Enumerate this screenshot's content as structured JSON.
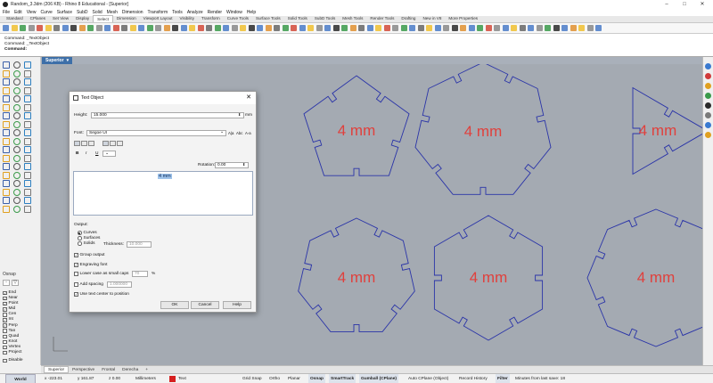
{
  "window": {
    "title": "Random_3.3dm (206 KB) - Rhino 8 Educational - [Superior]",
    "minimize": "–",
    "maximize": "□",
    "close": "✕"
  },
  "menu": [
    "File",
    "Edit",
    "View",
    "Curve",
    "Surface",
    "SubD",
    "Solid",
    "Mesh",
    "Dimension",
    "Transform",
    "Tools",
    "Analyze",
    "Render",
    "Window",
    "Help"
  ],
  "toolbar_tabs": [
    "Standard",
    "CPlanes",
    "Set View",
    "Display",
    "Select",
    "Dimension",
    "Viewport Layout",
    "Visibility",
    "Transform",
    "Curve Tools",
    "Surface Tools",
    "Solid Tools",
    "SubD Tools",
    "Mesh Tools",
    "Render Tools",
    "Drafting",
    "New in V8",
    "More Properties"
  ],
  "active_toolbar_tab": "Select",
  "command_history": [
    "Command: _TextObject",
    "Command: _TextObject"
  ],
  "command_prompt": "Command:",
  "osnap": {
    "title": "Osnap",
    "items": [
      {
        "label": "End",
        "checked": true
      },
      {
        "label": "Near",
        "checked": true
      },
      {
        "label": "Point",
        "checked": true
      },
      {
        "label": "Mid",
        "checked": true
      },
      {
        "label": "Cen",
        "checked": false
      },
      {
        "label": "Int",
        "checked": true
      },
      {
        "label": "Perp",
        "checked": true
      },
      {
        "label": "Tan",
        "checked": false
      },
      {
        "label": "Quad",
        "checked": false
      },
      {
        "label": "Knot",
        "checked": false
      },
      {
        "label": "Vertex",
        "checked": false
      },
      {
        "label": "Project",
        "checked": false
      }
    ],
    "disable_label": "Disable"
  },
  "viewport": {
    "name": "Superior",
    "menu_arrow": "▾",
    "text_label": "4 mm",
    "curve_color": "#2a34a8",
    "text_color": "#e0403c",
    "bg": "#a4aab2"
  },
  "viewport_tabs": [
    "Superior",
    "Perspective",
    "Frontal",
    "Derecha",
    "+"
  ],
  "active_viewport_tab": "Superior",
  "statusbar": {
    "cplane": "World",
    "x": "x -223.01",
    "y": "y 161.87",
    "z": "z 0.00",
    "units": "Millimeters",
    "layer_color": "#d62020",
    "layer": "Text",
    "toggles": [
      {
        "label": "Grid Snap",
        "on": false
      },
      {
        "label": "Ortho",
        "on": false
      },
      {
        "label": "Planar",
        "on": false
      },
      {
        "label": "Osnap",
        "on": true
      },
      {
        "label": "SmartTrack",
        "on": true
      },
      {
        "label": "Gumball (CPlane)",
        "on": true
      },
      {
        "label": "Auto CPlane (Object)",
        "on": false
      },
      {
        "label": "Record History",
        "on": false
      },
      {
        "label": "Filter",
        "on": true
      }
    ],
    "save_info": "Minutes from last save: 18"
  },
  "dialog": {
    "title": "Text Object",
    "close": "✕",
    "height_label": "Height:",
    "height_value": "15.000",
    "height_unit": "mm",
    "font_label": "Font:",
    "font_value": "Segoe UI",
    "font_btn1": "A|a",
    "font_btn2": "Abc",
    "font_btn3": "A-a",
    "bold": "B",
    "italic": "I",
    "underline": "U",
    "style_dropdown": "⌄",
    "rotation_label": "Rotation:",
    "rotation_value": "0.00",
    "text_value": "4 mm",
    "output_label": "Output:",
    "out_curves": "Curves",
    "out_surfaces": "Surfaces",
    "out_solids": "Solids",
    "thickness_label": "Thickness:",
    "thickness_value": "10.000",
    "group_output": "Group output",
    "engraving_font": "Engraving font",
    "lowercase_caps": "Lower case as small caps",
    "lowercase_value": "70",
    "percent": "%",
    "add_spacing": "Add spacing",
    "spacing_value": "1.000000",
    "use_text_center": "Use text center to position",
    "ok": "OK",
    "cancel": "Cancel",
    "help": "Help"
  }
}
